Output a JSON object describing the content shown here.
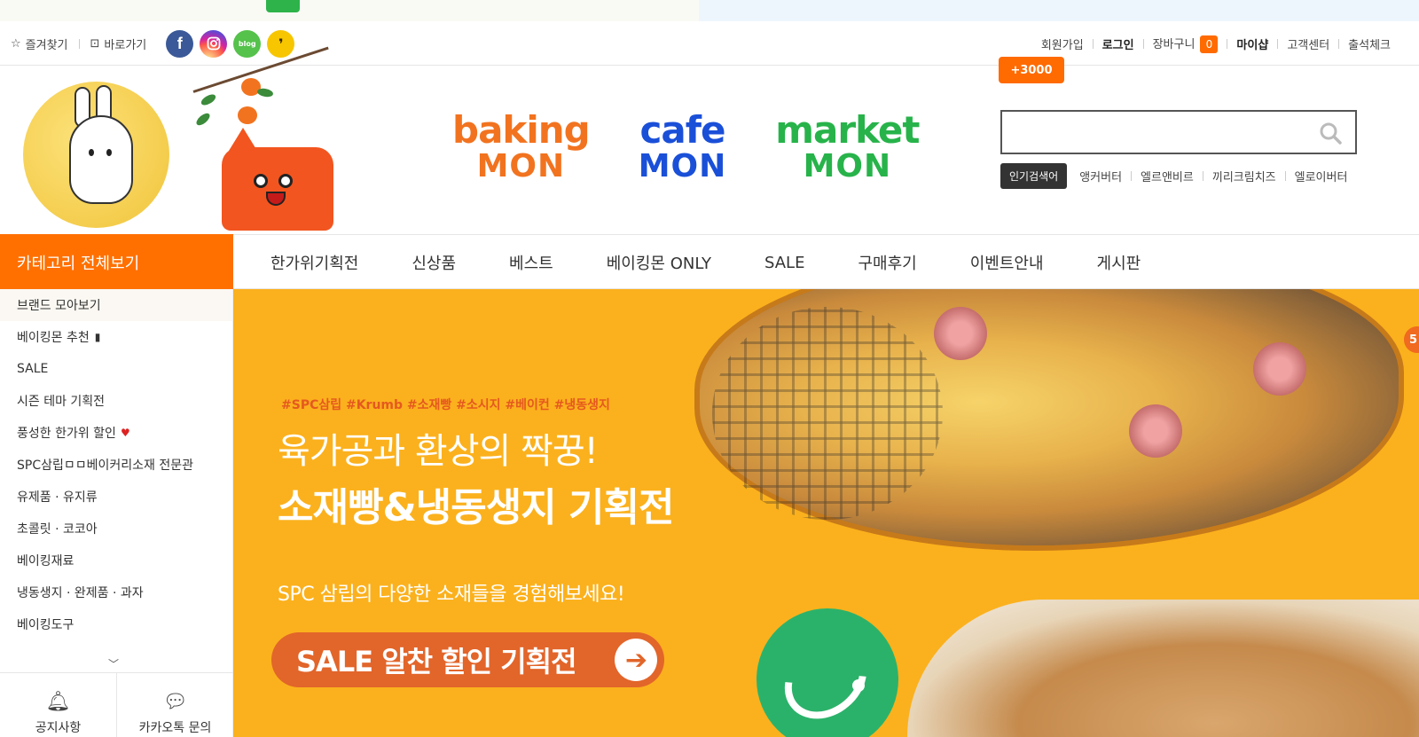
{
  "util": {
    "bookmark": "즐겨찾기",
    "shortcut": "바로가기",
    "sns": {
      "facebook": "f",
      "instagram": "",
      "blog": "blog",
      "kakao": "❜"
    },
    "signup": "회원가입",
    "login": "로그인",
    "cart": "장바구니",
    "cart_count": "0",
    "mypage": "마이샵",
    "support": "고객센터",
    "attendance": "출석체크",
    "points": "+3000"
  },
  "brands": [
    {
      "word": "baking",
      "mon": "MON",
      "color": "#f2731f"
    },
    {
      "word": "cafe",
      "mon": "MON",
      "color": "#1a4fd8"
    },
    {
      "word": "market",
      "mon": "MON",
      "color": "#27b34a"
    }
  ],
  "search": {
    "placeholder": "",
    "popular_tag": "인기검색어",
    "keywords": [
      "앵커버터",
      "엘르앤비르",
      "끼리크림치즈",
      "엘로이버터"
    ]
  },
  "nav": {
    "category_all": "카테고리 전체보기",
    "items": [
      "한가위기획전",
      "신상품",
      "베스트",
      "베이킹몬 ONLY",
      "SALE",
      "구매후기",
      "이벤트안내",
      "게시판"
    ]
  },
  "sidebar": {
    "items": [
      "브랜드 모아보기",
      "베이킹몬 추천",
      "SALE",
      "시즌 테마 기획전",
      "풍성한 한가위 할인",
      "SPC삼립ㅁㅁ베이커리소재 전문관",
      "유제품 · 유지류",
      "초콜릿 · 코코아",
      "베이킹재료",
      "냉동생지 · 완제품 · 과자",
      "베이킹도구"
    ],
    "notice": "공지사항",
    "kakao_inquiry": "카카오톡 문의"
  },
  "banner": {
    "tags": "#SPC삼립 #Krumb #소재빵 #소시지 #베이컨 #냉동생지",
    "headline1": "육가공과 환상의 짝꿍!",
    "headline2": "소재빵&냉동생지 기획전",
    "subtitle": "SPC 삼립의 다양한 소재들을 경험해보세요!",
    "cta": "SALE 알찬 할인 기획전",
    "slide_badge": "5"
  },
  "colors": {
    "accent": "#ff7000",
    "banner_bg": "#fbb11d",
    "cta": "#e2652a"
  }
}
